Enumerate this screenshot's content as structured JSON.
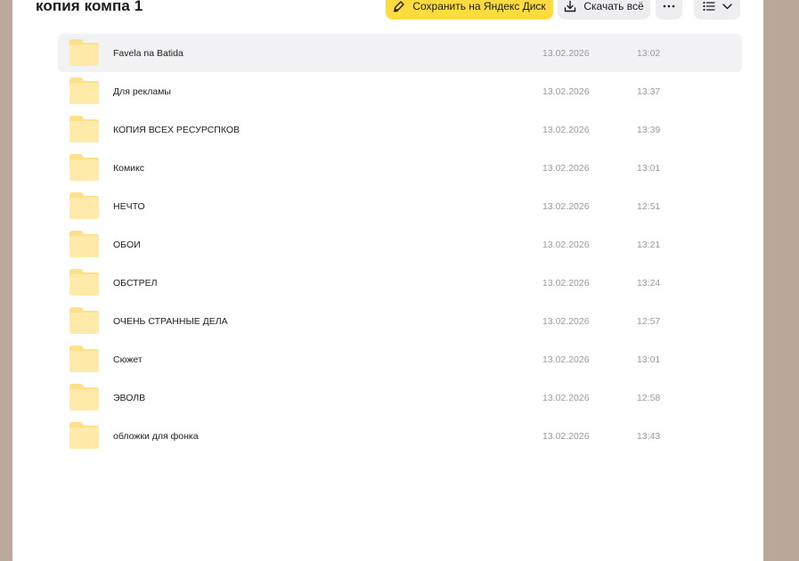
{
  "header": {
    "title": "копия компа 1",
    "save_label": "Сохранить на Яндекс Диск",
    "download_label": "Скачать всё"
  },
  "colors": {
    "accent": "#ffdc3d",
    "panel": "#ffffff",
    "folder": "#ffe08a"
  },
  "files": [
    {
      "name": "Favela na Batida",
      "date": "13.02.2026",
      "time": "13:02"
    },
    {
      "name": "Для рекламы",
      "date": "13.02.2026",
      "time": "13:37"
    },
    {
      "name": "КОПИЯ ВСЕХ РЕСУРСПКОВ",
      "date": "13.02.2026",
      "time": "13:39"
    },
    {
      "name": "Комикс",
      "date": "13.02.2026",
      "time": "13:01"
    },
    {
      "name": "НЕЧТО",
      "date": "13.02.2026",
      "time": "12:51"
    },
    {
      "name": "ОБОИ",
      "date": "13.02.2026",
      "time": "13:21"
    },
    {
      "name": "ОБСТРЕЛ",
      "date": "13.02.2026",
      "time": "13:24"
    },
    {
      "name": "ОЧЕНЬ СТРАННЫЕ ДЕЛА",
      "date": "13.02.2026",
      "time": "12:57"
    },
    {
      "name": "Сюжет",
      "date": "13.02.2026",
      "time": "13:01"
    },
    {
      "name": "ЭВОЛВ",
      "date": "13.02.2026",
      "time": "12:58"
    },
    {
      "name": "обложки для фонка",
      "date": "13.02.2026",
      "time": "13:43"
    }
  ]
}
